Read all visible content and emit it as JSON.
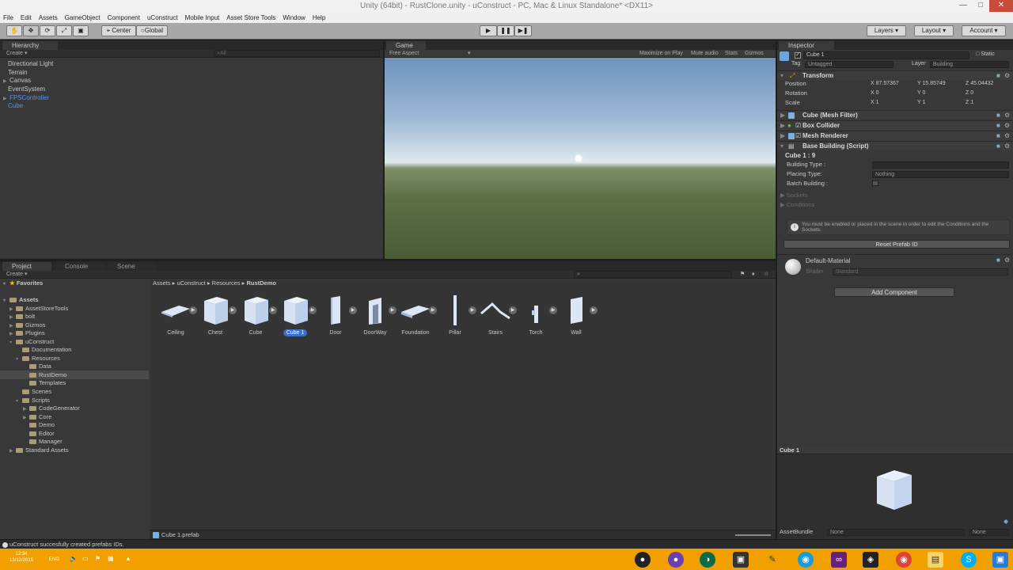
{
  "window": {
    "title": "Unity (64bit) - RustClone.unity - uConstruct - PC, Mac & Linux Standalone* <DX11>"
  },
  "menu": [
    "File",
    "Edit",
    "Assets",
    "GameObject",
    "Component",
    "uConstruct",
    "Mobile Input",
    "Asset Store Tools",
    "Window",
    "Help"
  ],
  "toolbar": {
    "pivot": "Center",
    "space": "Global",
    "layers": "Layers",
    "layout": "Layout",
    "account": "Account"
  },
  "hierarchy": {
    "tab": "Hierarchy",
    "create": "Create",
    "search_placeholder": "All",
    "items": [
      {
        "label": "Directional Light",
        "style": "normal"
      },
      {
        "label": "Terrain",
        "style": "normal"
      },
      {
        "label": "Canvas",
        "style": "normal"
      },
      {
        "label": "EventSystem",
        "style": "normal"
      },
      {
        "label": "FPSController",
        "style": "blue"
      },
      {
        "label": "Cube",
        "style": "blue"
      }
    ]
  },
  "game": {
    "tab": "Game",
    "aspect": "Free Aspect",
    "maximize": "Maximize on Play",
    "mute": "Mute audio",
    "stats": "Stats",
    "gizmos": "Gizmos"
  },
  "inspector": {
    "tab": "Inspector",
    "object_name": "Cube 1",
    "static": "Static",
    "tag_label": "Tag",
    "tag_value": "Untagged",
    "layer_label": "Layer",
    "layer_value": "Building",
    "transform": {
      "title": "Transform",
      "position_label": "Position",
      "rotation_label": "Rotation",
      "scale_label": "Scale",
      "position": {
        "x": "87.57367",
        "y": "15.85749",
        "z": "45.04432"
      },
      "rotation": {
        "x": "0",
        "y": "0",
        "z": "0"
      },
      "scale": {
        "x": "1",
        "y": "1",
        "z": "1"
      }
    },
    "components": [
      "Cube (Mesh Filter)",
      "Box Collider",
      "Mesh Renderer",
      "Base Building (Script)"
    ],
    "script": {
      "header": "Cube 1 : 9",
      "building_type_label": "Building Type :",
      "building_type_value": "",
      "placing_type_label": "Placing Type:",
      "placing_type_value": "Nothing",
      "batch_label": "Batch Building :",
      "sockets": "Sockets",
      "conditions": "Conditions",
      "info": "You must be enabled or placed in the scene in order to edit the Conditions and the Sockets.",
      "reset": "Reset Prefab ID"
    },
    "material": {
      "name": "Default-Material",
      "shader_label": "Shader",
      "shader_value": "Standard"
    },
    "add_component": "Add Component",
    "preview_title": "Cube 1",
    "assetbundle_label": "AssetBundle",
    "assetbundle_value": "None",
    "assetbundle_variant": "None"
  },
  "project": {
    "tabs": [
      "Project",
      "Console",
      "Scene"
    ],
    "create": "Create",
    "favorites": "Favorites",
    "tree": [
      {
        "label": "Assets",
        "indent": 0,
        "bold": true
      },
      {
        "label": "AssetStoreTools",
        "indent": 1
      },
      {
        "label": "bolt",
        "indent": 1
      },
      {
        "label": "Gizmos",
        "indent": 1
      },
      {
        "label": "Plugins",
        "indent": 1
      },
      {
        "label": "uConstruct",
        "indent": 1
      },
      {
        "label": "Documentation",
        "indent": 2
      },
      {
        "label": "Resources",
        "indent": 2
      },
      {
        "label": "Data",
        "indent": 3
      },
      {
        "label": "RustDemo",
        "indent": 3,
        "selected": true
      },
      {
        "label": "Templates",
        "indent": 3
      },
      {
        "label": "Scenes",
        "indent": 2
      },
      {
        "label": "Scripts",
        "indent": 2
      },
      {
        "label": "CodeGenerator",
        "indent": 3
      },
      {
        "label": "Core",
        "indent": 3
      },
      {
        "label": "Demo",
        "indent": 3
      },
      {
        "label": "Editor",
        "indent": 3
      },
      {
        "label": "Manager",
        "indent": 3
      },
      {
        "label": "Standard Assets",
        "indent": 1
      }
    ],
    "breadcrumb": [
      "Assets",
      "uConstruct",
      "Resources",
      "RustDemo"
    ],
    "assets": [
      {
        "label": "Ceiling",
        "shape": "flat"
      },
      {
        "label": "Chest",
        "shape": "cube"
      },
      {
        "label": "Cube",
        "shape": "cube"
      },
      {
        "label": "Cube 1",
        "shape": "cube",
        "selected": true
      },
      {
        "label": "Door",
        "shape": "door"
      },
      {
        "label": "DoorWay",
        "shape": "doorway"
      },
      {
        "label": "Foundation",
        "shape": "flat"
      },
      {
        "label": "Pillar",
        "shape": "pillar"
      },
      {
        "label": "Stairs",
        "shape": "stairs"
      },
      {
        "label": "Torch",
        "shape": "torch"
      },
      {
        "label": "Wall",
        "shape": "wall"
      }
    ],
    "footer_file": "Cube 1.prefab"
  },
  "status": {
    "message": "uConstruct succesfully created prefabs IDs."
  },
  "taskbar": {
    "time": "12:34",
    "date": "13/12/2015",
    "lang": "ENG"
  },
  "colors": {
    "accent": "#3a6fd0",
    "taskbar": "#f2a000",
    "selection_text": "#5b93e6"
  }
}
